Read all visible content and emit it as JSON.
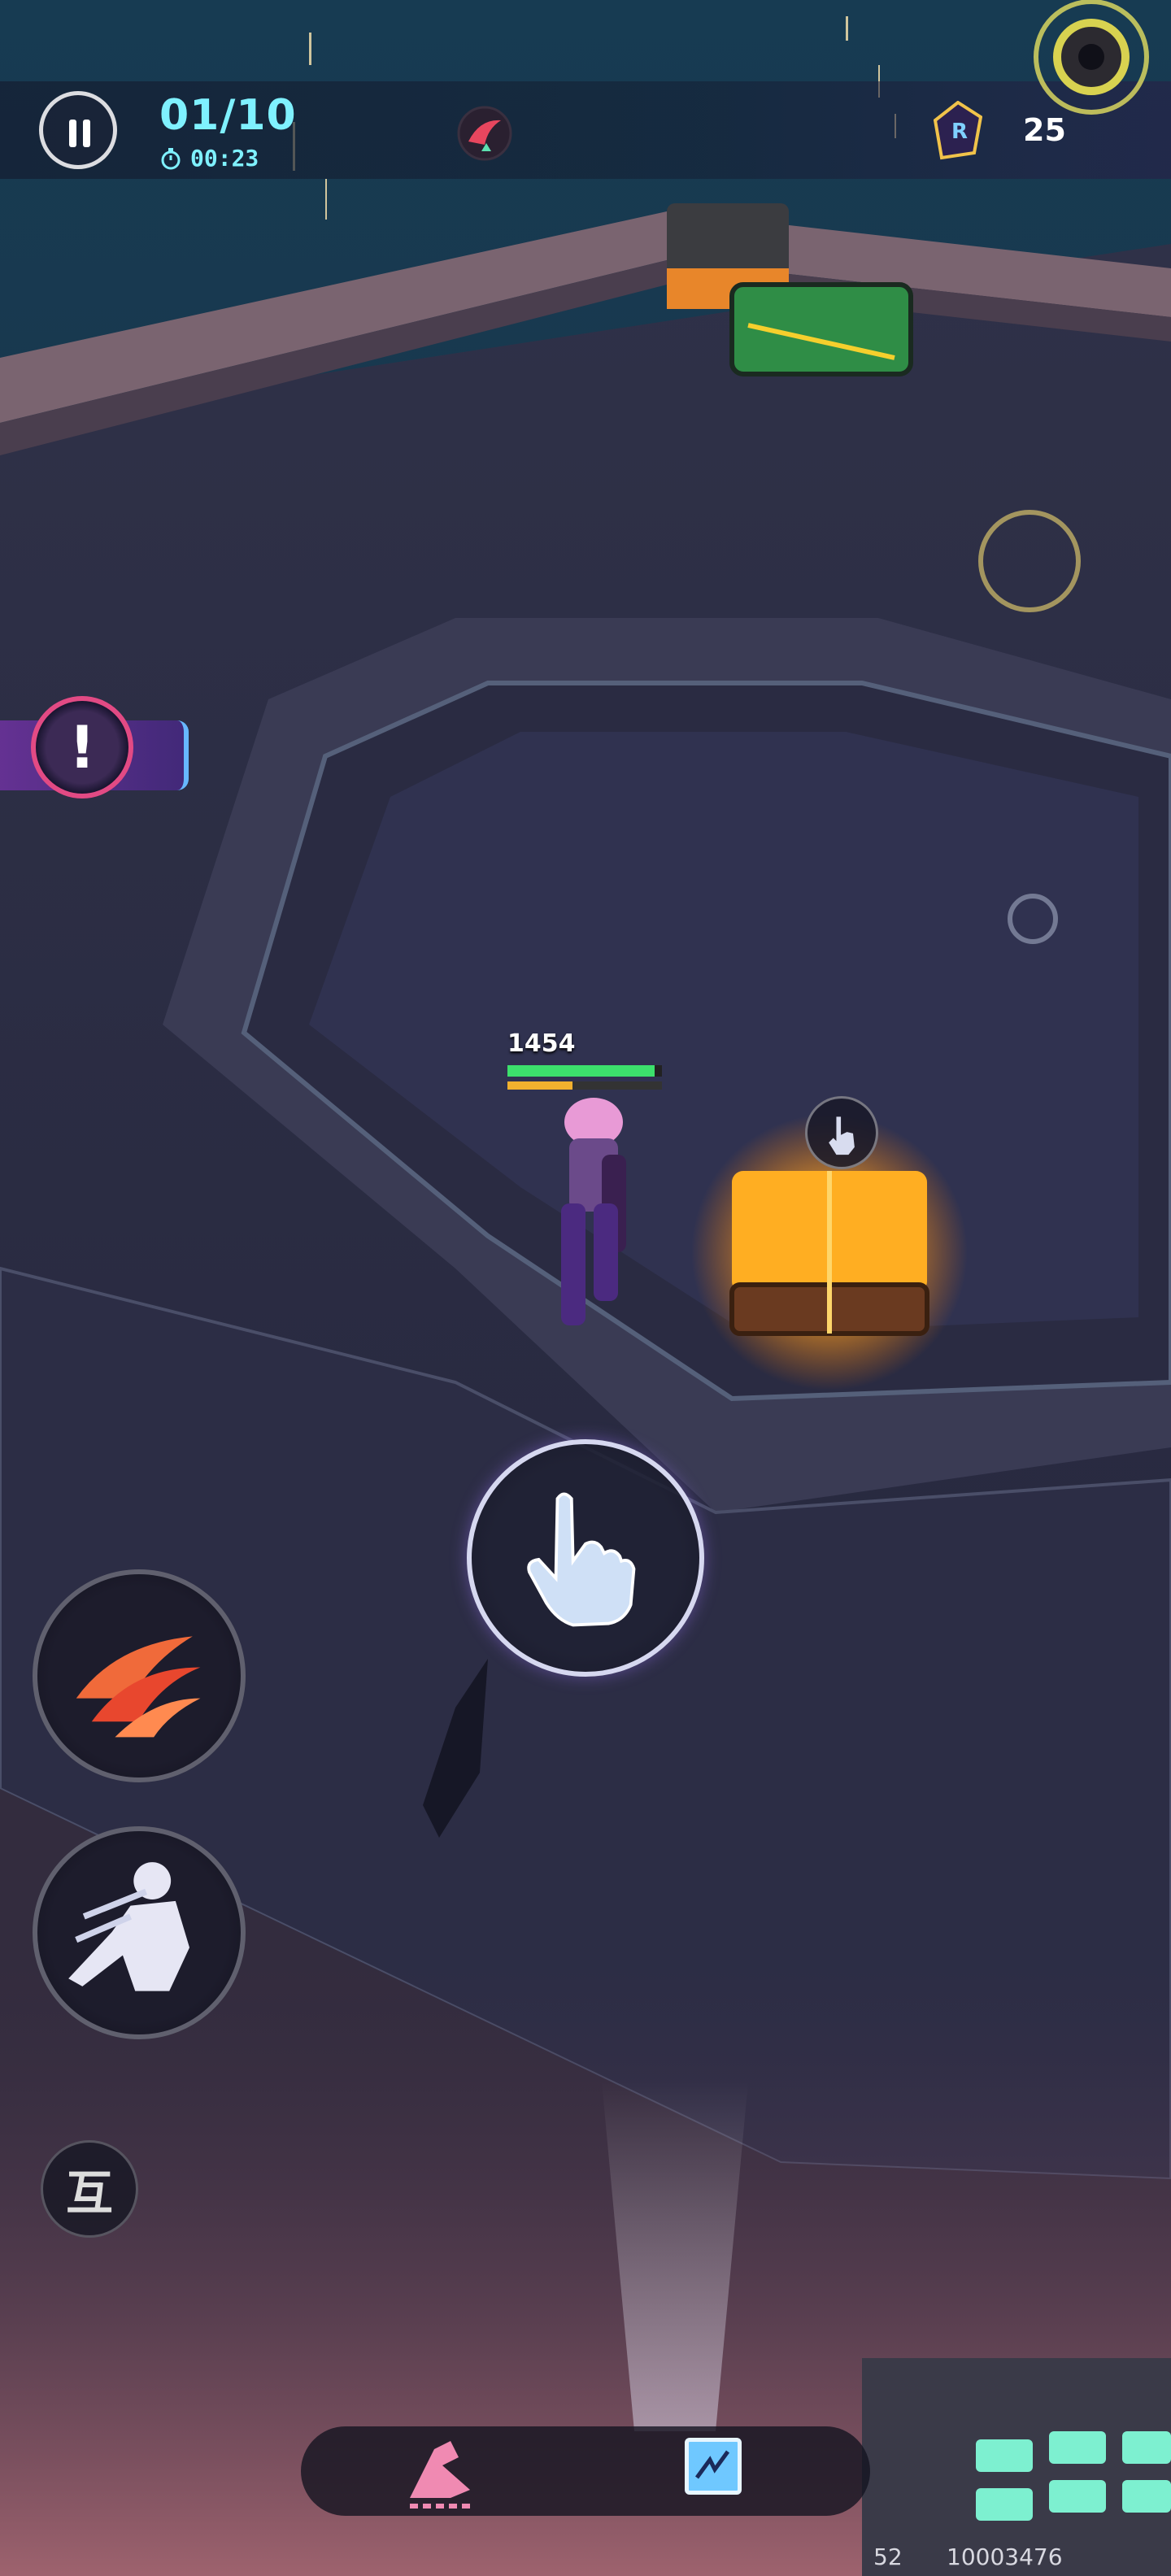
{
  "hud": {
    "wave": "01/10",
    "timer": "00:23",
    "currency": "25"
  },
  "alert": {
    "glyph": "!"
  },
  "player": {
    "hp_value": "1454",
    "hp_fraction": 0.95,
    "energy_fraction": 0.42
  },
  "controls": {
    "swap_glyph": "互"
  },
  "footer": {
    "fps": "52",
    "uid": "10003476"
  },
  "icons": {
    "pause": "pause-icon",
    "timer": "stopwatch-icon",
    "boss": "boss-icon",
    "currency": "crystal-currency-icon",
    "interact": "pointing-hand-icon",
    "skill_1": "claw-slash-icon",
    "skill_2": "dash-figure-icon",
    "tab_blade": "blade-icon",
    "tab_card": "card-icon"
  },
  "colors": {
    "accent_cyan": "#7ff1ff",
    "hp_green": "#3ce06c",
    "energy_orange": "#f2b12e",
    "alert_pink": "#e24a84",
    "chest_glow": "#ffb820"
  }
}
